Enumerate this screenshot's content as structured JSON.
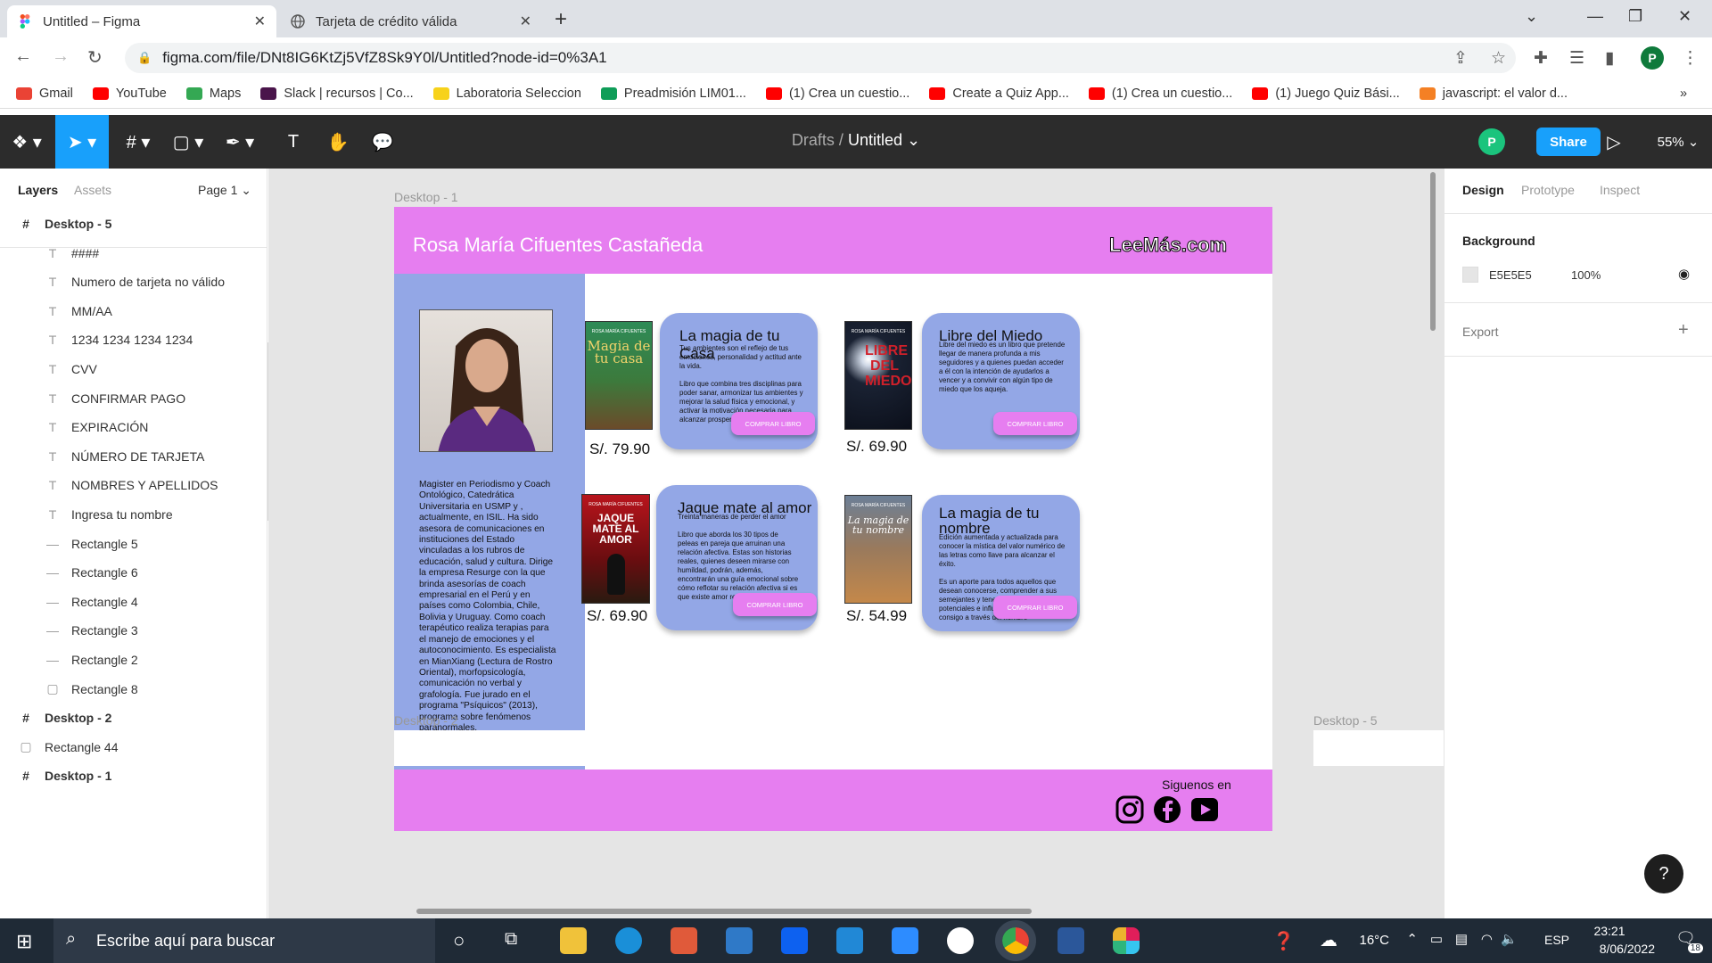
{
  "browser": {
    "tabs": [
      {
        "label": "Untitled – Figma",
        "active": true,
        "favicon": "figma-icon"
      },
      {
        "label": "Tarjeta de crédito válida",
        "active": false,
        "favicon": "globe-icon"
      }
    ],
    "url": "figma.com/file/DNt8IG6KtZj5VfZ8Sk9Y0l/Untitled?node-id=0%3A1",
    "profile_initial": "P",
    "bookmarks": [
      {
        "label": "Gmail",
        "color": "#ea4335"
      },
      {
        "label": "YouTube",
        "color": "#ff0000"
      },
      {
        "label": "Maps",
        "color": "#34a853"
      },
      {
        "label": "Slack | recursos | Co...",
        "color": "#4a154b"
      },
      {
        "label": "Laboratoria Seleccion",
        "color": "#f7d21b"
      },
      {
        "label": "Preadmisión LIM01...",
        "color": "#0f9d58"
      },
      {
        "label": "(1) Crea un cuestio...",
        "color": "#ff0000"
      },
      {
        "label": "Create a Quiz App...",
        "color": "#ff0000"
      },
      {
        "label": "(1) Crea un cuestio...",
        "color": "#ff0000"
      },
      {
        "label": "(1) Juego Quiz Bási...",
        "color": "#ff0000"
      },
      {
        "label": "javascript: el valor d...",
        "color": "#f48024"
      }
    ],
    "more": "»"
  },
  "figma": {
    "breadcrumb_parent": "Drafts",
    "breadcrumb_sep": "/",
    "file_name": "Untitled",
    "share_label": "Share",
    "user_initial": "P",
    "zoom": "55%",
    "left_tabs": {
      "layers": "Layers",
      "assets": "Assets",
      "page": "Page 1"
    },
    "layers": [
      {
        "name": "Desktop - 5",
        "type": "frame"
      },
      {
        "name": "####",
        "type": "text"
      },
      {
        "name": "Numero de tarjeta no válido",
        "type": "text"
      },
      {
        "name": "MM/AA",
        "type": "text"
      },
      {
        "name": "1234 1234 1234 1234",
        "type": "text"
      },
      {
        "name": "CVV",
        "type": "text"
      },
      {
        "name": "CONFIRMAR PAGO",
        "type": "text"
      },
      {
        "name": "EXPIRACIÓN",
        "type": "text"
      },
      {
        "name": "NÚMERO DE TARJETA",
        "type": "text"
      },
      {
        "name": "NOMBRES Y APELLIDOS",
        "type": "text"
      },
      {
        "name": "Ingresa tu nombre",
        "type": "text"
      },
      {
        "name": "Rectangle 5",
        "type": "line"
      },
      {
        "name": "Rectangle 6",
        "type": "line"
      },
      {
        "name": "Rectangle 4",
        "type": "line"
      },
      {
        "name": "Rectangle 3",
        "type": "line"
      },
      {
        "name": "Rectangle 2",
        "type": "line"
      },
      {
        "name": "Rectangle 8",
        "type": "rect"
      },
      {
        "name": "Desktop - 2",
        "type": "frame"
      },
      {
        "name": "Rectangle 44",
        "type": "rect"
      },
      {
        "name": "Desktop - 1",
        "type": "frame"
      }
    ],
    "right_tabs": {
      "design": "Design",
      "prototype": "Prototype",
      "inspect": "Inspect"
    },
    "background_label": "Background",
    "background_hex": "E5E5E5",
    "background_opacity": "100%",
    "export_label": "Export",
    "help": "?"
  },
  "canvas": {
    "frame_labels": {
      "desktop1": "Desktop - 1",
      "desktop2": "Desktop - 2",
      "desktop5": "Desktop - 5"
    },
    "design": {
      "author": "Rosa María Cifuentes Castañeda",
      "logo": "LeeMás.com",
      "bio": "Magister en Periodismo y Coach Ontológico, Catedrática Universitaria en USMP y , actualmente, en ISIL. Ha sido asesora de comunicaciones en instituciones del Estado vinculadas a los rubros de educación, salud y cultura. Dirige la empresa Resurge con la que brinda asesorías de coach empresarial en el Perú y en países como Colombia, Chile, Bolivia y Uruguay. Como coach terapéutico realiza terapias para el manejo de emociones y el autoconocimiento. Es especialista en MianXiang (Lectura de Rostro Oriental), morfopsicología, comunicación no verbal y grafología. Fue jurado en el programa \"Psíquicos\" (2013), programa sobre fenómenos paranormales.",
      "buy_label": "COMPRAR LIBRO",
      "follow": "Siguenos en",
      "books": [
        {
          "cover_author": "ROSA MARÍA CIFUENTES",
          "cover_title": "Magia de tu casa",
          "price": "S/. 79.90",
          "title": "La magia de tu Casa",
          "desc": "Tus ambientes son el reflejo de tus emociones, personalidad y actitud ante la vida.\n\nLibro que combina tres disciplinas para poder sanar, armonizar tus ambientes y mejorar la salud física y emocional, y activar la motivación necesaria para alcanzar prosperidad."
        },
        {
          "cover_author": "ROSA MARÍA CIFUENTES",
          "cover_title": "LIBRE DEL MIEDO",
          "price": "S/. 69.90",
          "title": "Libre del Miedo",
          "desc": "Libre del miedo es un libro que pretende llegar de manera profunda a mis seguidores y a quienes puedan acceder a él con la intención de ayudarlos a vencer y a convivir con algún tipo de miedo que los aqueja."
        },
        {
          "cover_author": "ROSA MARÍA CIFUENTES",
          "cover_title": "JAQUE MATE AL AMOR",
          "price": "S/. 69.90",
          "title": "Jaque mate al amor",
          "desc": "Treinta maneras de perder el amor\n\nLibro que aborda los 30 tipos de peleas en pareja que arruinan una relación afectiva. Estas son historias reales, quienes deseen mirarse con humildad, podrán, además, encontrarán una guía emocional sobre cómo reflotar su relación afectiva si es que existe amor real en la pareja."
        },
        {
          "cover_author": "ROSA MARÍA CIFUENTES",
          "cover_title": "La magia de tu nombre",
          "price": "S/. 54.99",
          "title": "La magia de tu nombre",
          "desc": "Edición aumentada y actualizada para conocer la mística del valor numérico de las letras como llave para alcanzar el éxito.\n\nEs un aporte para todos aquellos que desean conocerse, comprender a sus semejantes y tener claridad acerca de los potenciales e influencias que traen consigo a través del nombre"
        }
      ]
    }
  },
  "taskbar": {
    "search_placeholder": "Escribe aquí para buscar",
    "temperature": "16°C",
    "language": "ESP",
    "time": "23:21",
    "date": "8/06/2022",
    "notifications": "18"
  }
}
